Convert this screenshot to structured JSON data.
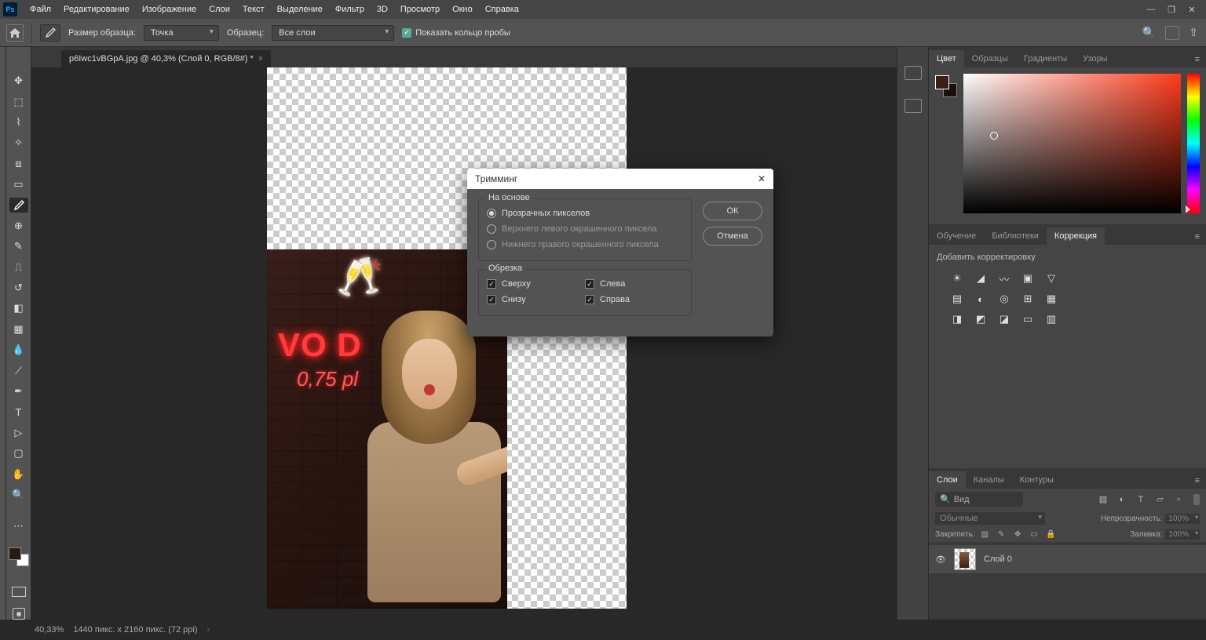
{
  "menu": {
    "items": [
      "Файл",
      "Редактирование",
      "Изображение",
      "Слои",
      "Текст",
      "Выделение",
      "Фильтр",
      "3D",
      "Просмотр",
      "Окно",
      "Справка"
    ]
  },
  "options": {
    "sample_size_label": "Размер образца:",
    "sample_size_value": "Точка",
    "sample_label": "Образец:",
    "sample_value": "Все слои",
    "show_ring_label": "Показать кольцо пробы"
  },
  "doc_tab": {
    "title": "p6Iwc1vBGpA.jpg @ 40,3% (Слой 0, RGB/8#) *"
  },
  "dialog": {
    "title": "Тримминг",
    "ok": "ОК",
    "cancel": "Отмена",
    "based_on": {
      "legend": "На основе",
      "opt_transparent": "Прозрачных пикселов",
      "opt_top_left": "Верхнего левого окрашенного пиксела",
      "opt_bottom_right": "Нижнего правого окрашенного пиксела"
    },
    "trim_away": {
      "legend": "Обрезка",
      "top": "Сверху",
      "left": "Слева",
      "bottom": "Снизу",
      "right": "Справа"
    }
  },
  "panels": {
    "color_tabs": [
      "Цвет",
      "Образцы",
      "Градиенты",
      "Узоры"
    ],
    "mid_tabs": [
      "Обучение",
      "Библиотеки",
      "Коррекция"
    ],
    "add_adjustment": "Добавить корректировку",
    "layers_tabs": [
      "Слои",
      "Каналы",
      "Контуры"
    ],
    "search_placeholder": "Вид",
    "blend_mode": "Обычные",
    "opacity_label": "Непрозрачность:",
    "opacity_value": "100%",
    "lock_label": "Закрепить:",
    "fill_label": "Заливка:",
    "fill_value": "100%",
    "layer0_name": "Слой 0"
  },
  "status": {
    "zoom": "40,33%",
    "dims": "1440 пикс. x 2160 пикс. (72 ppi)"
  },
  "neon": {
    "line1": "VO D",
    "line2": "0,75 pl"
  }
}
